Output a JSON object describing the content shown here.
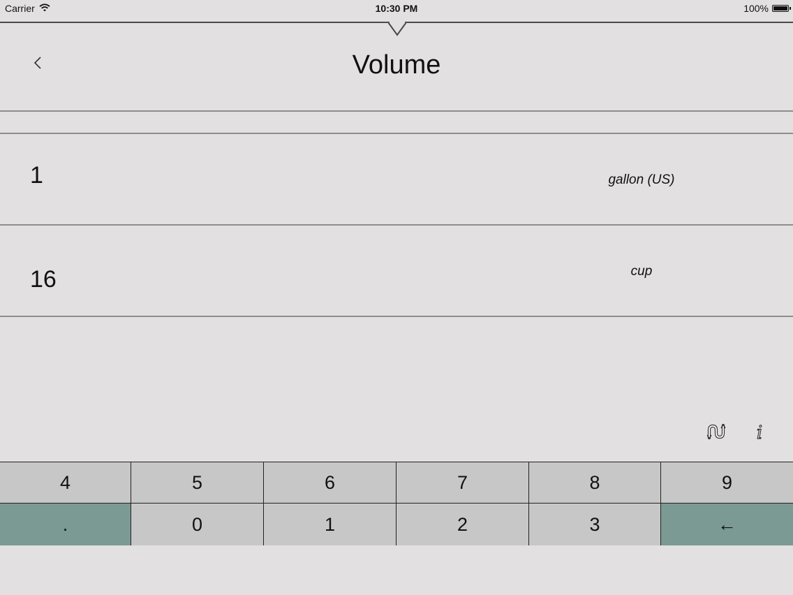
{
  "status_bar": {
    "carrier": "Carrier",
    "time": "10:30 PM",
    "battery": "100%"
  },
  "header": {
    "title": "Volume",
    "back_icon": "chevron-left-icon"
  },
  "conversions": [
    {
      "value": "1",
      "unit": "gallon (US)"
    },
    {
      "value": "16",
      "unit": "cup"
    }
  ],
  "tools": {
    "swap_icon": "swap-units-icon",
    "info_icon": "info-icon"
  },
  "keypad": {
    "row1": [
      "4",
      "5",
      "6",
      "7",
      "8",
      "9"
    ],
    "row2": [
      ".",
      "0",
      "1",
      "2",
      "3",
      "←"
    ]
  },
  "colors": {
    "background": "#e2e0e1",
    "key": "#c8c7c8",
    "accent_key": "#7c9a94"
  }
}
